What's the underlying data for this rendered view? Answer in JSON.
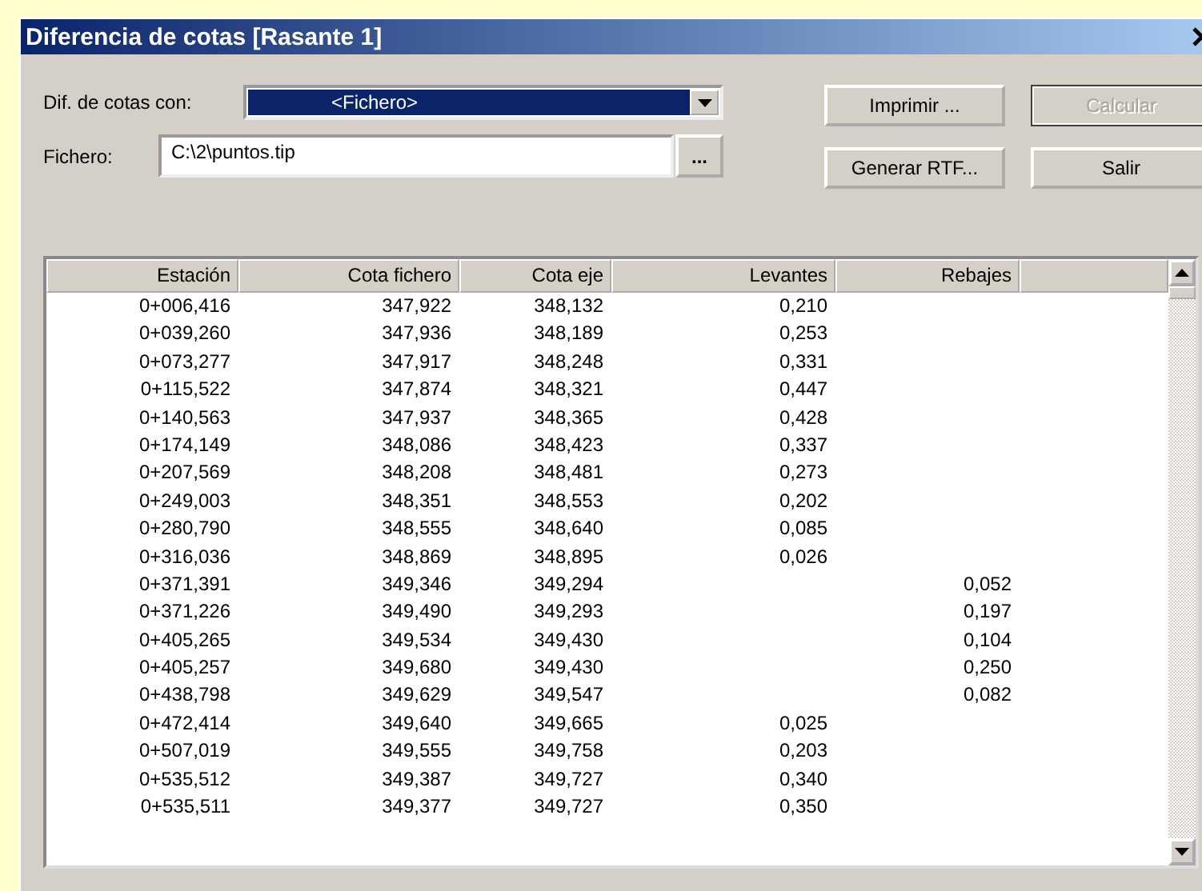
{
  "window": {
    "title": "Diferencia de cotas [Rasante 1]"
  },
  "compare_with": {
    "label": "Dif. de cotas con:",
    "value": "<Fichero>"
  },
  "file": {
    "label": "Fichero:",
    "value": "C:\\2\\puntos.tip",
    "browse": "..."
  },
  "buttons": [
    {
      "label": "Imprimir ...",
      "disabled": false
    },
    {
      "label": "Calcular",
      "disabled": true
    },
    {
      "label": "Generar RTF...",
      "disabled": false
    },
    {
      "label": "Salir",
      "disabled": false
    }
  ],
  "table": {
    "columns": [
      "Estación",
      "Cota fichero",
      "Cota eje",
      "Levantes",
      "Rebajes"
    ],
    "rows": [
      [
        "0+006,416",
        "347,922",
        "348,132",
        "0,210",
        null
      ],
      [
        "0+039,260",
        "347,936",
        "348,189",
        "0,253",
        null
      ],
      [
        "0+073,277",
        "347,917",
        "348,248",
        "0,331",
        null
      ],
      [
        "0+115,522",
        "347,874",
        "348,321",
        "0,447",
        null
      ],
      [
        "0+140,563",
        "347,937",
        "348,365",
        "0,428",
        null
      ],
      [
        "0+174,149",
        "348,086",
        "348,423",
        "0,337",
        null
      ],
      [
        "0+207,569",
        "348,208",
        "348,481",
        "0,273",
        null
      ],
      [
        "0+249,003",
        "348,351",
        "348,553",
        "0,202",
        null
      ],
      [
        "0+280,790",
        "348,555",
        "348,640",
        "0,085",
        null
      ],
      [
        "0+316,036",
        "348,869",
        "348,895",
        "0,026",
        null
      ],
      [
        "0+371,391",
        "349,346",
        "349,294",
        null,
        "0,052"
      ],
      [
        "0+371,226",
        "349,490",
        "349,293",
        null,
        "0,197"
      ],
      [
        "0+405,265",
        "349,534",
        "349,430",
        null,
        "0,104"
      ],
      [
        "0+405,257",
        "349,680",
        "349,430",
        null,
        "0,250"
      ],
      [
        "0+438,798",
        "349,629",
        "349,547",
        null,
        "0,082"
      ],
      [
        "0+472,414",
        "349,640",
        "349,665",
        "0,025",
        null
      ],
      [
        "0+507,019",
        "349,555",
        "349,758",
        "0,203",
        null
      ],
      [
        "0+535,512",
        "349,387",
        "349,727",
        "0,340",
        null
      ],
      [
        "0+535,511",
        "349,377",
        "349,727",
        "0,350",
        null
      ]
    ]
  }
}
